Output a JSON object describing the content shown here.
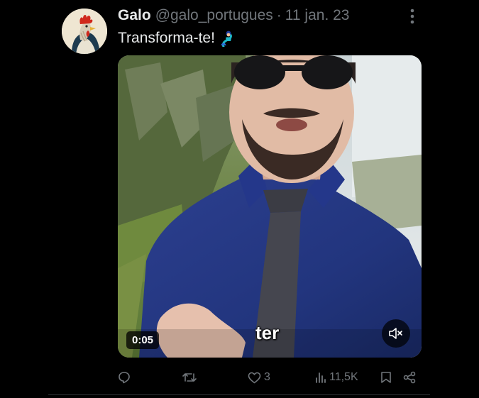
{
  "tweet": {
    "display_name": "Galo",
    "handle": "@galo_portugues",
    "separator": "·",
    "date": "11 jan. 23",
    "text": "Transforma-te!",
    "emoji": "genie-emoji",
    "avatar": "rooster-avatar"
  },
  "video": {
    "duration": "0:05",
    "caption": "ter",
    "muted": true
  },
  "actions": {
    "reply_count": "",
    "retweet_count": "",
    "like_count": "3",
    "views_count": "11,5K"
  },
  "colors": {
    "background": "#000000",
    "text_primary": "#e7e9ea",
    "text_secondary": "#71767b",
    "divider": "#2f3336"
  }
}
